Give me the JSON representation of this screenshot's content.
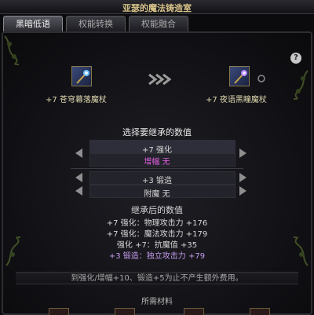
{
  "window": {
    "title": "亚瑟的魔法铸造室"
  },
  "tabs": [
    {
      "label": "黑暗低语",
      "active": true
    },
    {
      "label": "权能转换",
      "active": false
    },
    {
      "label": "权能融合",
      "active": false
    }
  ],
  "help": {
    "label": "?"
  },
  "source_item": {
    "name": "+7 苍穹幕落魔杖",
    "icon": "staff-icon"
  },
  "target_item": {
    "name": "+7 夜语黑瞳魔杖",
    "icon": "staff-icon"
  },
  "transfer_icon": "double-chevron-right-icon",
  "inherit": {
    "prompt": "选择要继承的数值",
    "rows": [
      {
        "line1": "+7 强化",
        "line2": "增幅 无"
      },
      {
        "line1": "+3 锻造",
        "line2": "附魔 无"
      }
    ]
  },
  "result": {
    "heading": "继承后的数值",
    "lines": [
      "+7 强化：物理攻击力 +176",
      "+7 强化：魔法攻击力 +179",
      "强化 +7：抗魔值 +35",
      "+3 锻造：独立攻击力 +79"
    ]
  },
  "note": "到强化/增幅+10、锻造+5为止不产生额外费用。",
  "materials": {
    "heading": "所需材料"
  },
  "colors": {
    "gold": "#d8c48a",
    "pink": "#e060e0",
    "purple": "#c79cf0"
  }
}
